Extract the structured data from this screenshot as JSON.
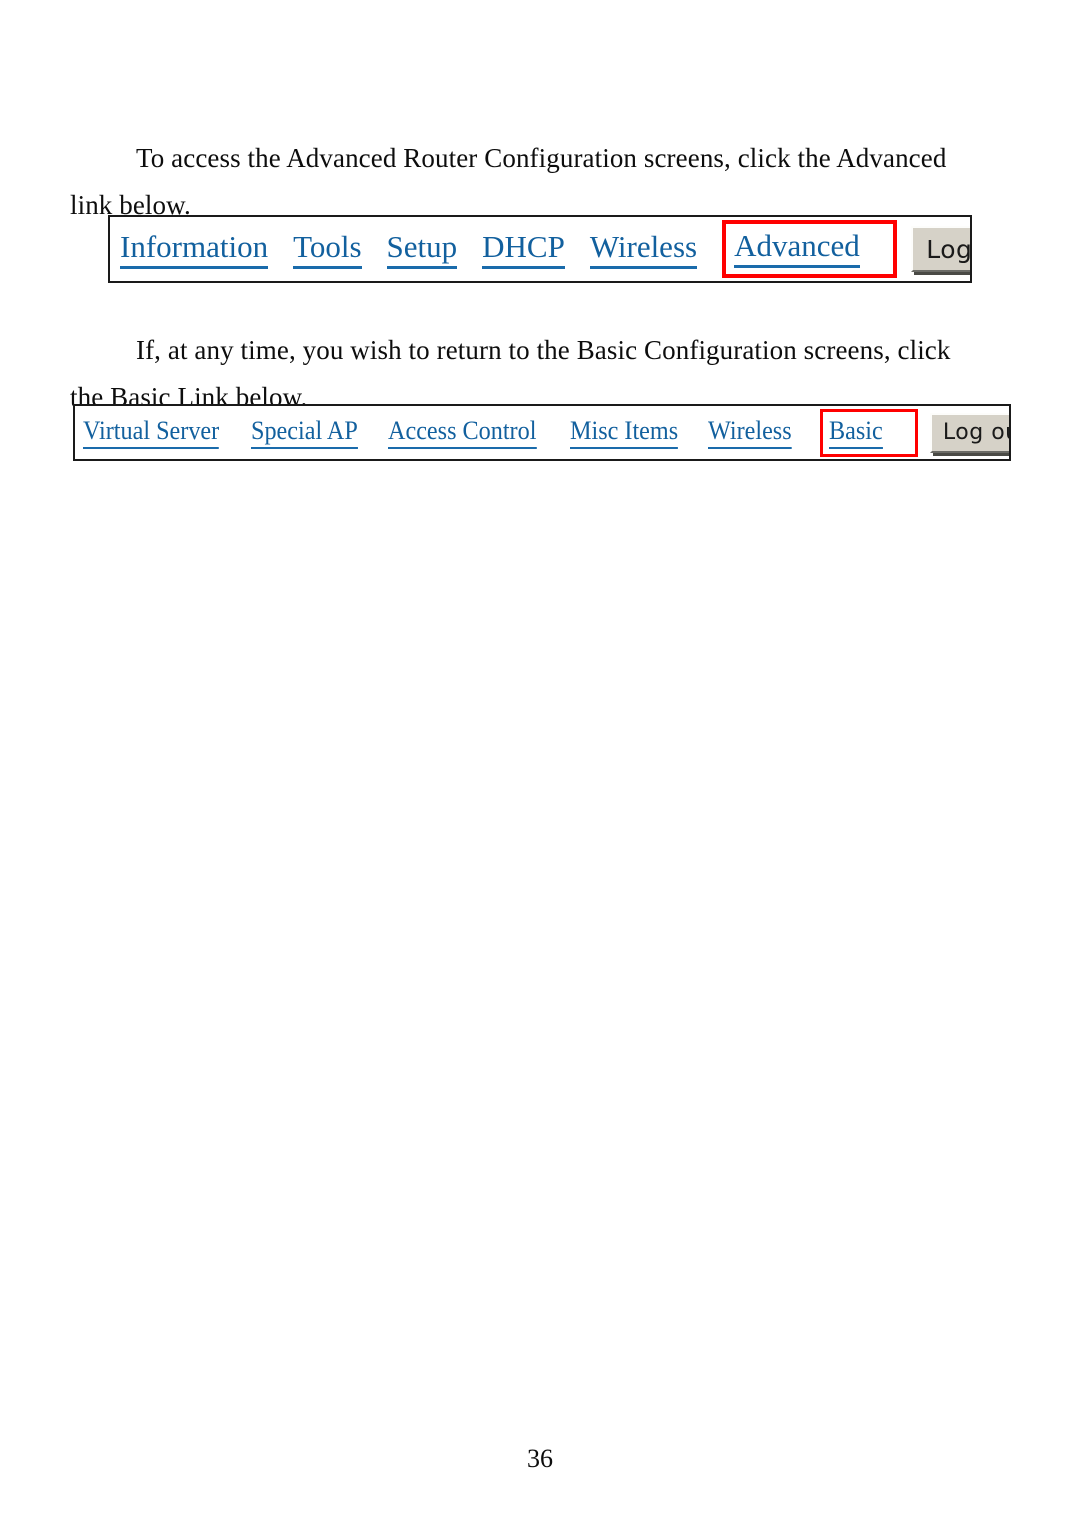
{
  "document": {
    "page_number": "36",
    "paragraphs": [
      {
        "id": "para-1",
        "text": "To access the Advanced Router Configuration screens, click the Advanced link below."
      },
      {
        "id": "para-2",
        "text": "If, at any time, you wish to return to the Basic Configuration screens, click the Basic Link below."
      }
    ]
  },
  "figure_advanced_navbar": {
    "links": [
      {
        "label": "Information",
        "highlighted": false
      },
      {
        "label": "Tools",
        "highlighted": false
      },
      {
        "label": "Setup",
        "highlighted": false
      },
      {
        "label": "DHCP",
        "highlighted": false
      },
      {
        "label": "Wireless",
        "highlighted": false
      },
      {
        "label": "Advanced",
        "highlighted": true
      }
    ],
    "logout_label": "Log out",
    "highlight_color": "#ff0000",
    "link_color": "#12609e"
  },
  "figure_basic_navbar": {
    "links": [
      {
        "label": "Virtual Server",
        "highlighted": false
      },
      {
        "label": "Special AP",
        "highlighted": false
      },
      {
        "label": "Access Control",
        "highlighted": false
      },
      {
        "label": "Misc Items",
        "highlighted": false
      },
      {
        "label": "Wireless",
        "highlighted": false
      },
      {
        "label": "Basic",
        "highlighted": true
      }
    ],
    "logout_label": "Log out",
    "highlight_color": "#ff0000",
    "link_color": "#12609e"
  }
}
